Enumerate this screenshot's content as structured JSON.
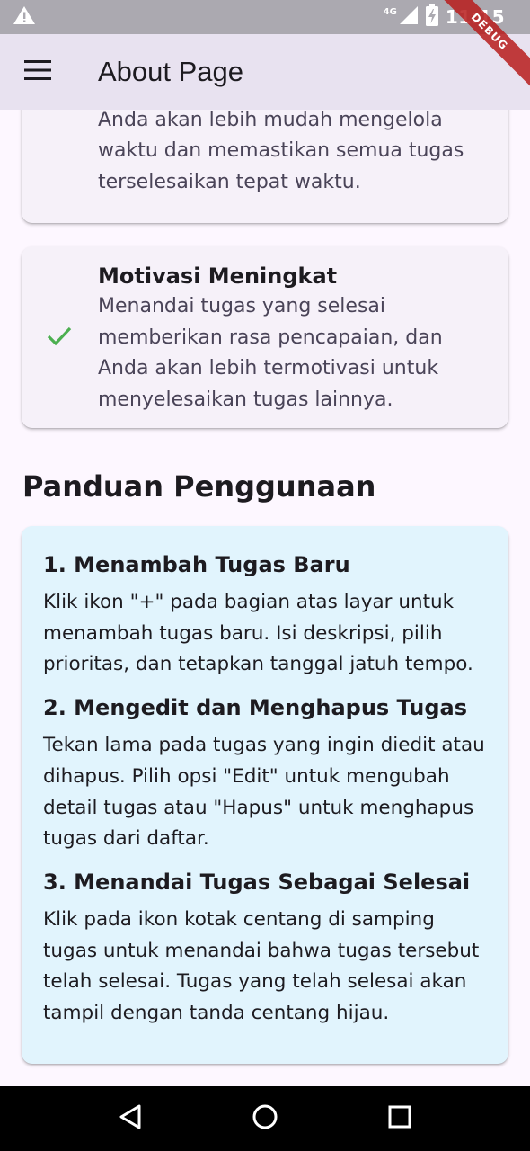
{
  "status_bar": {
    "time": "11:15",
    "network": "4G",
    "icons": [
      "warning-icon",
      "signal-icon",
      "battery-icon"
    ]
  },
  "debug_banner": "DEBUG",
  "app_bar": {
    "title": "About Page",
    "menu_icon": "hamburger-menu-icon",
    "background": "#E8E2F0"
  },
  "features": [
    {
      "title": "",
      "description": "Dengan fitur tanggal jatuh tempo, Anda akan lebih mudah mengelola waktu dan memastikan semua tugas terselesaikan tepat waktu.",
      "icon": "check-icon"
    },
    {
      "title": "Motivasi Meningkat",
      "description": "Menandai tugas yang selesai memberikan rasa pencapaian, dan Anda akan lebih termotivasi untuk menyelesaikan tugas lainnya.",
      "icon": "check-icon"
    }
  ],
  "guide": {
    "heading": "Panduan Penggunaan",
    "items": [
      {
        "title": "1. Menambah Tugas Baru",
        "description": "Klik ikon \"+\" pada bagian atas layar untuk menambah tugas baru. Isi deskripsi, pilih prioritas, dan tetapkan tanggal jatuh tempo."
      },
      {
        "title": "2. Mengedit dan Menghapus Tugas",
        "description": "Tekan lama pada tugas yang ingin diedit atau dihapus. Pilih opsi \"Edit\" untuk mengubah detail tugas atau \"Hapus\" untuk menghapus tugas dari daftar."
      },
      {
        "title": "3. Menandai Tugas Sebagai Selesai",
        "description": "Klik pada ikon kotak centang di samping tugas untuk menandai bahwa tugas tersebut telah selesai. Tugas yang telah selesai akan tampil dengan tanda centang hijau."
      }
    ]
  },
  "colors": {
    "check": "#4CAF50",
    "feature_card": "#F6F1F9",
    "guide_card": "#E1F4FD",
    "page_background": "#FDF7FF"
  },
  "nav_bar": {
    "icons": [
      "back-icon",
      "home-icon",
      "recents-icon"
    ]
  }
}
